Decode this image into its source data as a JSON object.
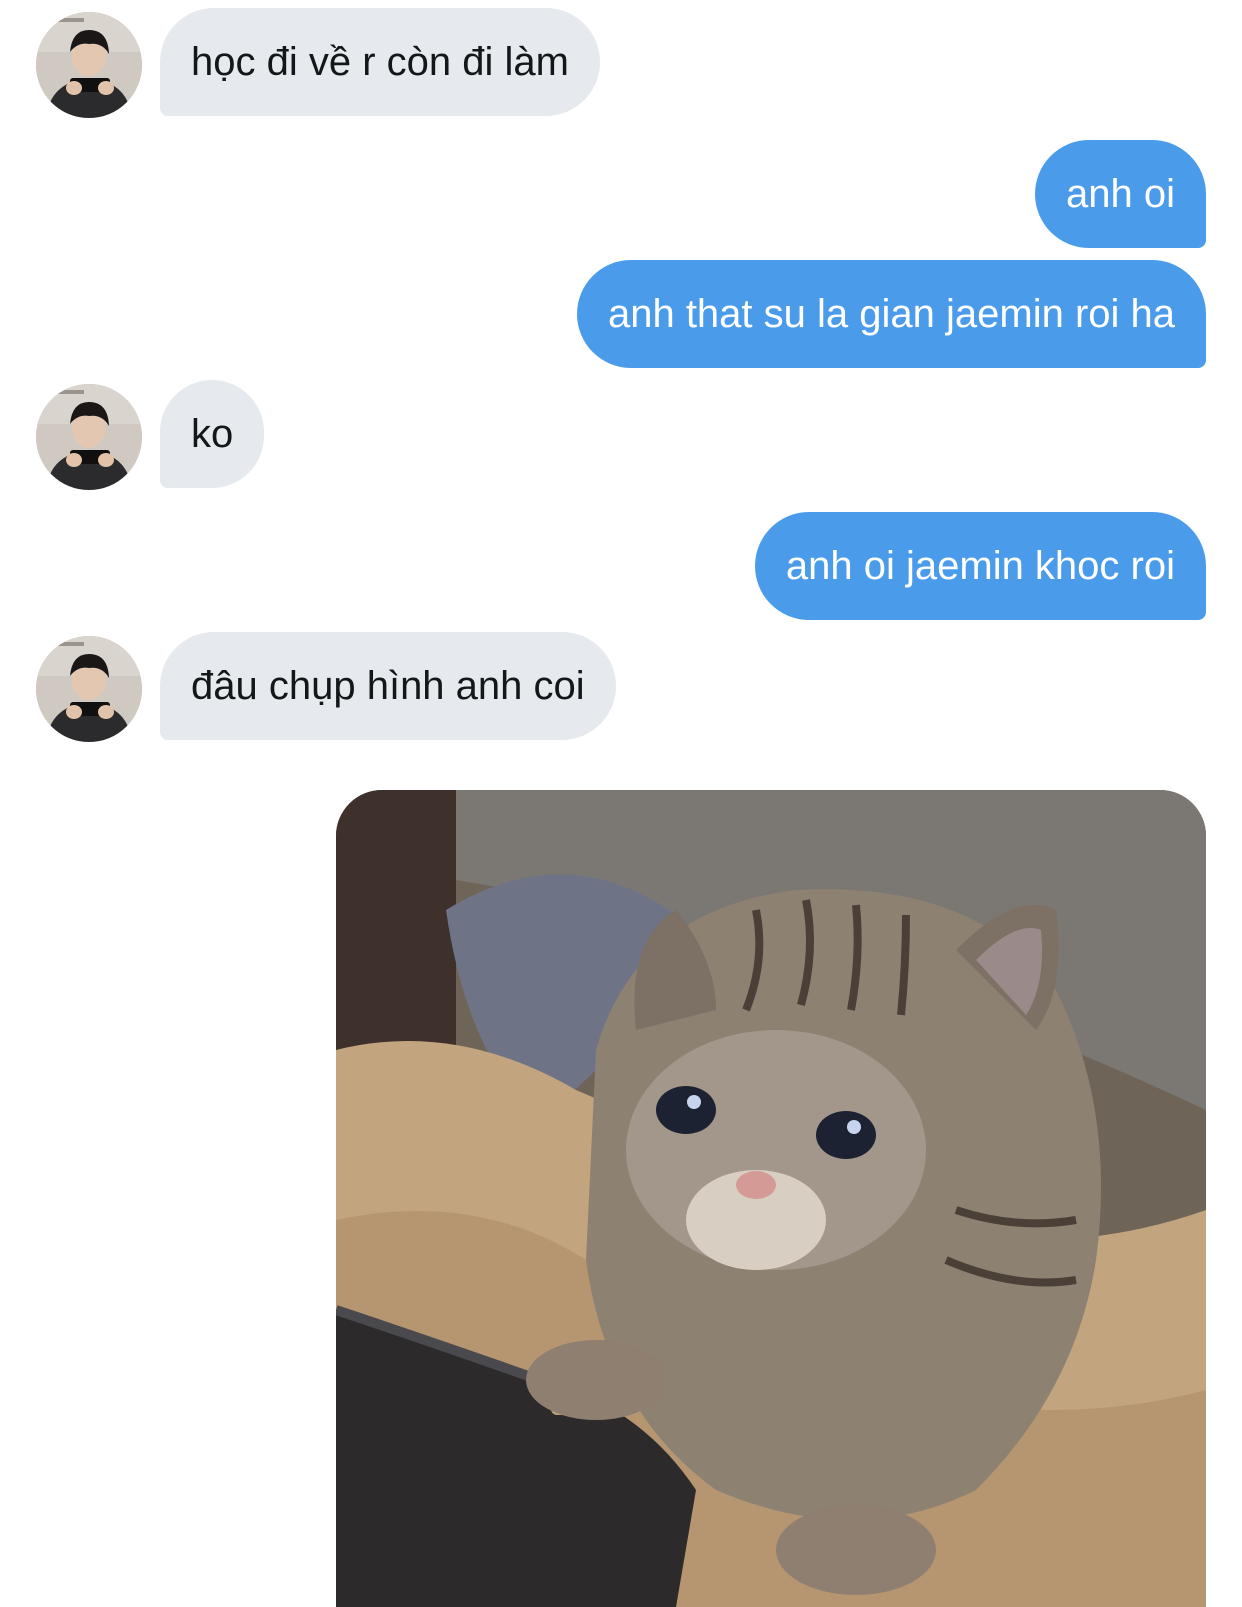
{
  "conversation": {
    "messages": [
      {
        "id": "m1",
        "direction": "incoming",
        "text": "học đi về r còn đi làm",
        "avatar_icon": "person-holding-phone-avatar"
      },
      {
        "id": "m2",
        "direction": "outgoing",
        "text": "anh oi"
      },
      {
        "id": "m3",
        "direction": "outgoing",
        "text": "anh that su la gian jaemin roi ha"
      },
      {
        "id": "m4",
        "direction": "incoming",
        "text": "ko",
        "avatar_icon": "person-holding-phone-avatar"
      },
      {
        "id": "m5",
        "direction": "outgoing",
        "text": "anh oi jaemin khoc roi"
      },
      {
        "id": "m6",
        "direction": "incoming",
        "text": "đâu chụp hình anh coi",
        "avatar_icon": "person-holding-phone-avatar"
      },
      {
        "id": "m7",
        "direction": "outgoing",
        "type": "image",
        "image_subject": "crying-cat-meme"
      }
    ]
  },
  "colors": {
    "incoming_bubble": "#e6e9ed",
    "incoming_text": "#14171a",
    "outgoing_bubble": "#4a9bea",
    "outgoing_text": "#ffffff",
    "background": "#ffffff"
  }
}
